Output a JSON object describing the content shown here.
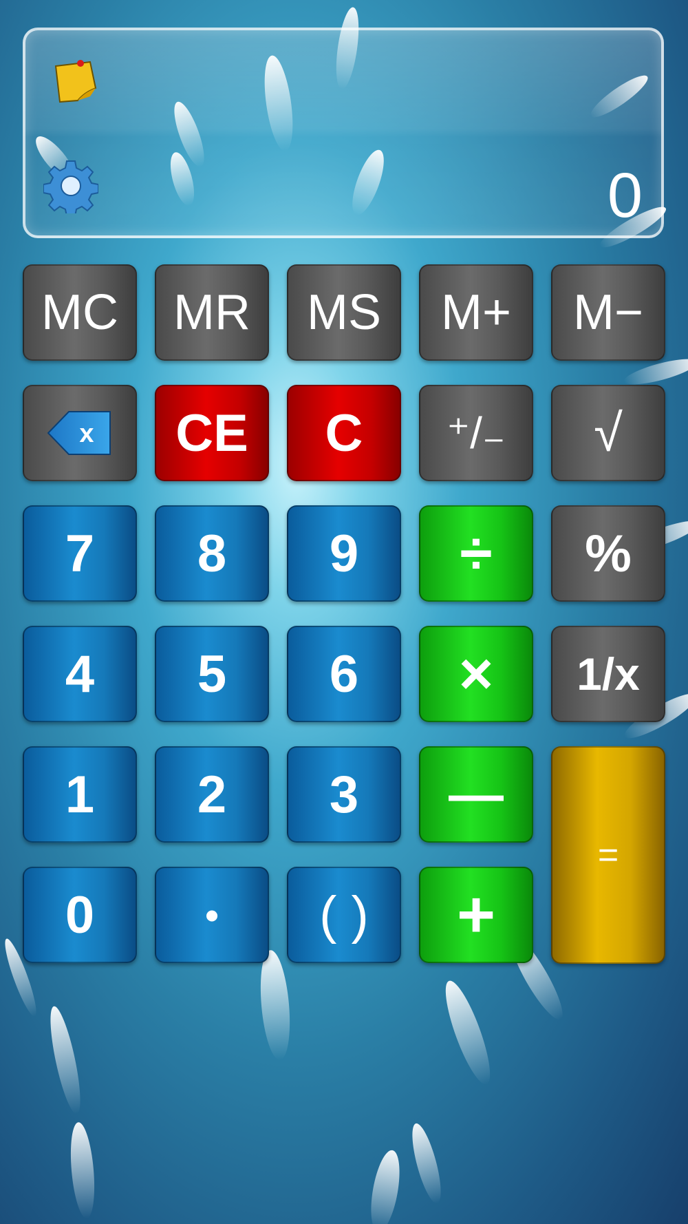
{
  "display": {
    "value": "0",
    "note_icon": "sticky-note-icon",
    "settings_icon": "gear-icon"
  },
  "memory_row": [
    "MC",
    "MR",
    "MS",
    "M+",
    "M−"
  ],
  "function_row": {
    "backspace_icon": "backspace-icon",
    "backspace_label": "x",
    "ce": "CE",
    "c": "C",
    "sign": "⁺/₋",
    "sqrt": "√"
  },
  "keys": {
    "seven": "7",
    "eight": "8",
    "nine": "9",
    "divide": "÷",
    "percent": "%",
    "four": "4",
    "five": "5",
    "six": "6",
    "multiply": "×",
    "reciprocal": "1/x",
    "one": "1",
    "two": "2",
    "three": "3",
    "minus": "—",
    "equals": "=",
    "zero": "0",
    "dot": "•",
    "parens": "( )",
    "plus": "+"
  },
  "colors": {
    "memory": "#5a5a5a",
    "clear": "#d40000",
    "digit": "#1579b9",
    "operator": "#16c416",
    "equals": "#d4a600"
  }
}
